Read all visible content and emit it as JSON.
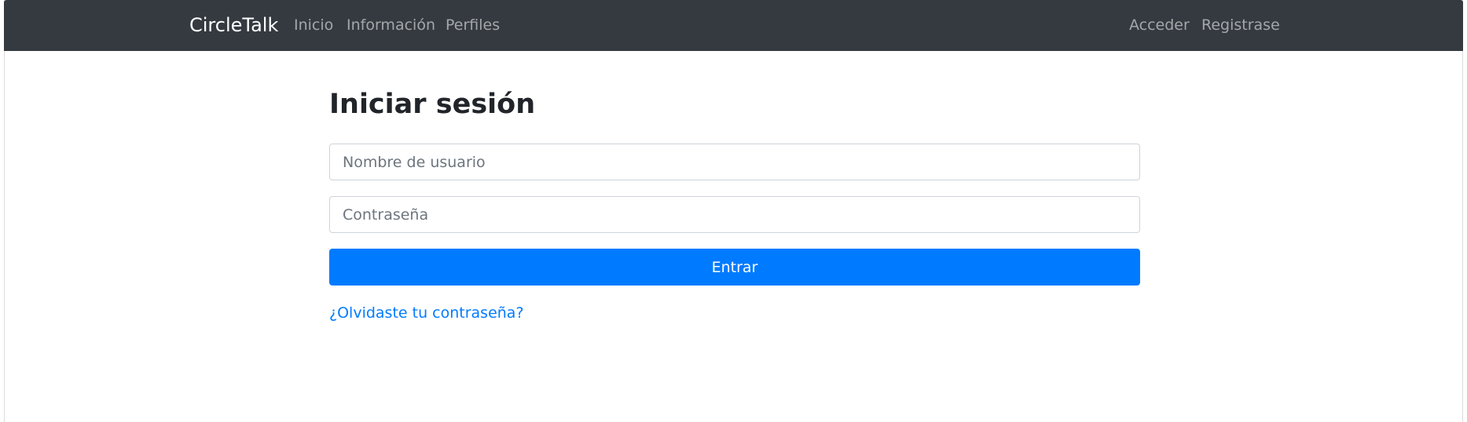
{
  "navbar": {
    "brand": "CircleTalk",
    "links": [
      "Inicio",
      "Información",
      "Perfiles"
    ],
    "right_links": [
      "Acceder",
      "Registrase"
    ],
    "background_color": "#343a40"
  },
  "main": {
    "title": "Iniciar sesión",
    "username_placeholder": "Nombre de usuario",
    "password_placeholder": "Contraseña",
    "submit_label": "Entrar",
    "forgot_link": "¿Olvidaste tu contraseña?",
    "accent_color": "#007bff"
  }
}
